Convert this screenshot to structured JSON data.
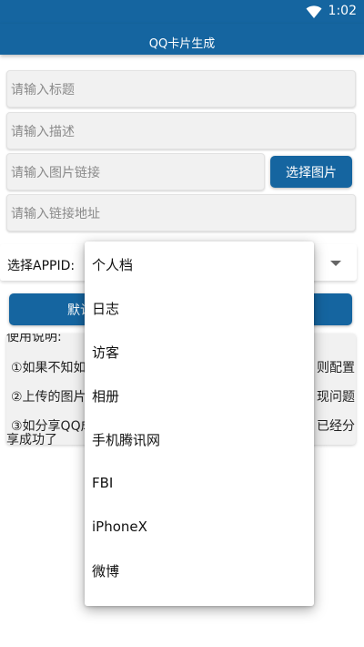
{
  "status_bar": {
    "time": "1:02",
    "wifi_icon": "wifi-icon"
  },
  "app_bar": {
    "title": "QQ卡片生成"
  },
  "form": {
    "title_placeholder": "请输入标题",
    "desc_placeholder": "请输入描述",
    "image_placeholder": "请输入图片链接",
    "pick_image_label": "选择图片",
    "url_placeholder": "请输入链接地址",
    "appid_label": "选择APPID:",
    "default_button_label": "默认"
  },
  "help": {
    "line1": "使用说明:",
    "line2": "①如果不知如",
    "line2_end": "则配置",
    "line3": "②上传的图片",
    "line3_end": "现问题",
    "line4": "③如分享QQ成",
    "line4_end": "已经分",
    "line5": "享成功了"
  },
  "dropdown": {
    "items": [
      "个人档",
      "日志",
      "访客",
      "相册",
      "手机腾讯网",
      "FBI",
      "iPhoneX",
      "微博"
    ]
  },
  "colors": {
    "primary": "#1565a0"
  }
}
